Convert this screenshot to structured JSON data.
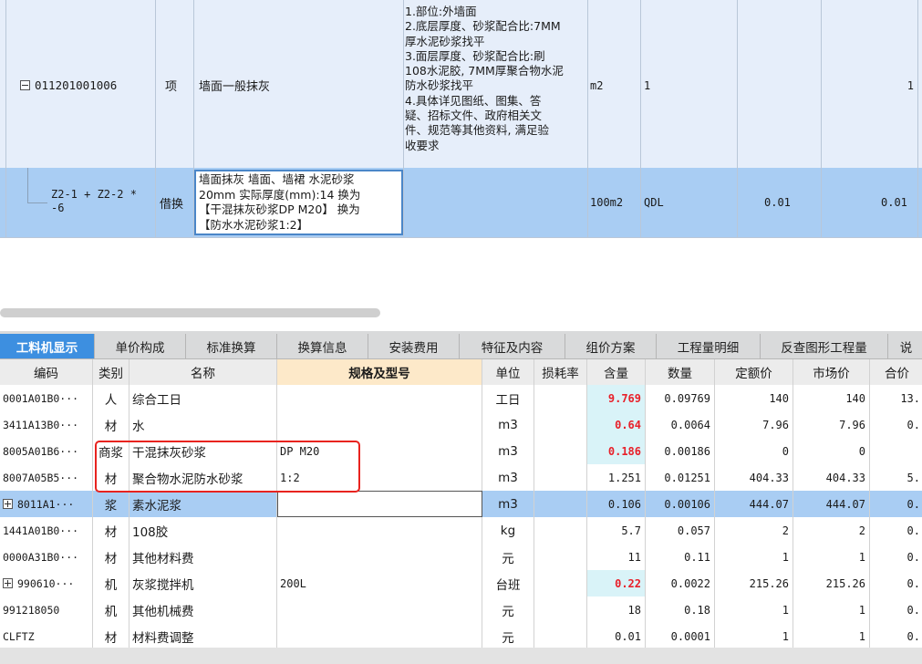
{
  "top": {
    "item": {
      "code": "011201001006",
      "type": "项",
      "name": "墙面一般抹灰",
      "features": "1.部位:外墙面\n2.底层厚度、砂浆配合比:7MM\n厚水泥砂浆找平\n3.面层厚度、砂浆配合比:刷\n108水泥胶, 7MM厚聚合物水泥\n防水砂浆找平\n4.具体详见图纸、图集、答\n疑、招标文件、政府相关文\n件、规范等其他资料, 满足验\n收要求",
      "unit": "m2",
      "expr": "1",
      "qty": "1"
    },
    "sub": {
      "code": "Z2-1 + Z2-2 *\n-6",
      "type": "借换",
      "name": "墙面抹灰 墙面、墙裙 水泥砂浆\n20mm  实际厚度(mm):14  换为\n【干混抹灰砂浆DP M20】  换为\n【防水水泥砂浆1:2】",
      "unit": "100m2",
      "expr": "QDL",
      "content": "0.01",
      "qty": "0.01"
    }
  },
  "tabs": [
    {
      "label": "工料机显示",
      "active": true
    },
    {
      "label": "单价构成",
      "active": false
    },
    {
      "label": "标准换算",
      "active": false
    },
    {
      "label": "换算信息",
      "active": false
    },
    {
      "label": "安装费用",
      "active": false
    },
    {
      "label": "特征及内容",
      "active": false
    },
    {
      "label": "组价方案",
      "active": false
    },
    {
      "label": "工程量明细",
      "active": false
    },
    {
      "label": "反查图形工程量",
      "active": false
    },
    {
      "label": "说",
      "active": false
    }
  ],
  "table": {
    "headers": [
      "编码",
      "类别",
      "名称",
      "规格及型号",
      "单位",
      "损耗率",
      "含量",
      "数量",
      "定额价",
      "市场价",
      "合价"
    ],
    "rows": [
      {
        "code": "0001A01B0···",
        "cat": "人",
        "name": "综合工日",
        "spec": "",
        "unit": "工日",
        "loss": "",
        "content": "9.769",
        "qty": "0.09769",
        "quota": "140",
        "market": "140",
        "total": "13.",
        "highlight": true,
        "expand": ""
      },
      {
        "code": "3411A13B0···",
        "cat": "材",
        "name": "水",
        "spec": "",
        "unit": "m3",
        "loss": "",
        "content": "0.64",
        "qty": "0.0064",
        "quota": "7.96",
        "market": "7.96",
        "total": "0.",
        "highlight": true,
        "expand": ""
      },
      {
        "code": "8005A01B6···",
        "cat": "商浆",
        "name": "干混抹灰砂浆",
        "spec": "DP M20",
        "unit": "m3",
        "loss": "",
        "content": "0.186",
        "qty": "0.00186",
        "quota": "0",
        "market": "0",
        "total": "",
        "highlight": true,
        "expand": ""
      },
      {
        "code": "8007A05B5···",
        "cat": "材",
        "name": "聚合物水泥防水砂浆",
        "spec": "1:2",
        "unit": "m3",
        "loss": "",
        "content": "1.251",
        "qty": "0.01251",
        "quota": "404.33",
        "market": "404.33",
        "total": "5.",
        "highlight": false,
        "expand": ""
      },
      {
        "code": "8011A1···",
        "cat": "浆",
        "name": "素水泥浆",
        "spec": "",
        "unit": "m3",
        "loss": "",
        "content": "0.106",
        "qty": "0.00106",
        "quota": "444.07",
        "market": "444.07",
        "total": "0.",
        "highlight": false,
        "expand": "plus",
        "selected": true
      },
      {
        "code": "1441A01B0···",
        "cat": "材",
        "name": "108胶",
        "spec": "",
        "unit": "kg",
        "loss": "",
        "content": "5.7",
        "qty": "0.057",
        "quota": "2",
        "market": "2",
        "total": "0.",
        "highlight": false,
        "expand": ""
      },
      {
        "code": "0000A31B0···",
        "cat": "材",
        "name": "其他材料费",
        "spec": "",
        "unit": "元",
        "loss": "",
        "content": "11",
        "qty": "0.11",
        "quota": "1",
        "market": "1",
        "total": "0.",
        "highlight": false,
        "expand": ""
      },
      {
        "code": "990610···",
        "cat": "机",
        "name": "灰浆搅拌机",
        "spec": "200L",
        "unit": "台班",
        "loss": "",
        "content": "0.22",
        "qty": "0.0022",
        "quota": "215.26",
        "market": "215.26",
        "total": "0.",
        "highlight": true,
        "expand": "plus"
      },
      {
        "code": "991218050",
        "cat": "机",
        "name": "其他机械费",
        "spec": "",
        "unit": "元",
        "loss": "",
        "content": "18",
        "qty": "0.18",
        "quota": "1",
        "market": "1",
        "total": "0.",
        "highlight": false,
        "expand": ""
      },
      {
        "code": "CLFTZ",
        "cat": "材",
        "name": "材料费调整",
        "spec": "",
        "unit": "元",
        "loss": "",
        "content": "0.01",
        "qty": "0.0001",
        "quota": "1",
        "market": "1",
        "total": "0.",
        "highlight": false,
        "expand": ""
      }
    ]
  },
  "colors": {
    "active_tab": "#3d8fe0",
    "highlight_red": "#e8202a",
    "selected_row": "#a9cdf3",
    "annotation_box": "#e8231f"
  }
}
